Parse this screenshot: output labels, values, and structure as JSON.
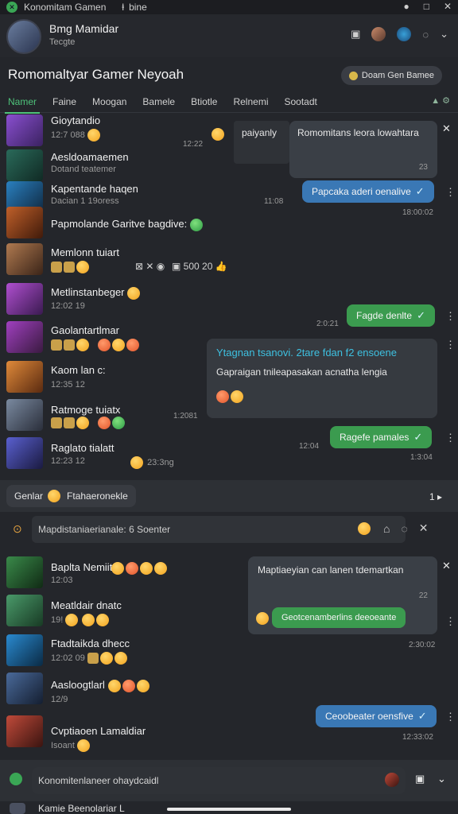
{
  "window": {
    "app_title": "Konomitam Gamen",
    "tab_label": "bine",
    "controls": [
      "●",
      "□",
      "✕"
    ]
  },
  "header": {
    "name": "Bmg Mamidar",
    "status": "Tecgte",
    "icons": [
      "window-icon",
      "avatar-mini",
      "globe-icon",
      "refresh-icon",
      "chevron-down-icon"
    ]
  },
  "chat": {
    "title": "Romomaltyar Gamer Neyoah",
    "action_button": "Doam Gen Bamee"
  },
  "tabs": [
    "Namer",
    "Faine",
    "Moogan",
    "Bamele",
    "Btiotle",
    "Relnemi",
    "Sootadt"
  ],
  "list_top": [
    {
      "name": "Gioytandio",
      "sub": "12:7  088",
      "time": "12:22",
      "bubble": "paiyanly"
    },
    {
      "name": "Aesldoamaemen",
      "sub": "Dotand teatemer",
      "time": "",
      "bubble": ""
    },
    {
      "name": "Kapentande haqen",
      "sub": "Dacian  1  19oress",
      "time": "11:08",
      "bubble": ""
    },
    {
      "name": "Papmolande Garitve bagdive:",
      "sub": "",
      "time": "",
      "bubble": ""
    },
    {
      "name": "Memlonn tuiart",
      "sub": "",
      "time": "",
      "bubble": "500 20"
    },
    {
      "name": "Metlinstanbeger",
      "sub": "12:02  19",
      "time": "",
      "bubble": ""
    },
    {
      "name": "Gaolantartlmar",
      "sub": "",
      "time": "2:0:21",
      "bubble": ""
    },
    {
      "name": "Kaom lan c:",
      "sub": "12:35  12",
      "time": "",
      "bubble": ""
    },
    {
      "name": "Ratmoge tuiatx",
      "sub": "",
      "time": "1:2081",
      "bubble": ""
    },
    {
      "name": "Raglato tialatt",
      "sub": "12:23  12",
      "time": "12:04",
      "bubble": "23:3ng"
    }
  ],
  "bubbles_top": {
    "popup_text": "Romomitans leora lowahtara",
    "popup_time": "23",
    "out_1": "Papcaka aderi oenalive",
    "out_1_time": "18:00:02",
    "out_2": "Fagde denlte",
    "highlight_title": "Ytagnan tsanovi. 2tare fdan f2 ensoene",
    "highlight_body": "Gapraigan tnileapasakan acnatha lengia",
    "out_3": "Ragefe pamales",
    "out_3_time": "1:3:04"
  },
  "group_bar": {
    "label": "Genlar",
    "text": "Ftahaeronekle",
    "right": "1 ▸"
  },
  "search": {
    "value": "Mapdistaniaerianale: 6 Soenter"
  },
  "list_bottom": [
    {
      "name": "Baplta Nemiit",
      "sub": "12:03"
    },
    {
      "name": "Meatldair dnatc",
      "sub": "19!"
    },
    {
      "name": "Ftadtaikda dhecc",
      "sub": "12:02  09"
    },
    {
      "name": "Aasloogtlarl",
      "sub": "12/9"
    },
    {
      "name": "Cvptiaoen Lamaldiar",
      "sub": "Isoant"
    }
  ],
  "bubbles_bottom": {
    "popup_text": "Maptiaeyian can lanen tdemartkan",
    "popup_time": "22",
    "popup_out": "Geotcenamberlins deeoeante",
    "popup_out_time": "2:30:02",
    "out_last": "Ceoobeater oensfive",
    "out_last_time": "12:33:02"
  },
  "composer": {
    "value": "Konomitenlaneer ohaydcaidl"
  },
  "footer": {
    "text": "Kamie Beenolariar L"
  },
  "colors": {
    "accent_green": "#3b9b4f",
    "accent_blue": "#3a78b5",
    "background": "#24262b"
  }
}
